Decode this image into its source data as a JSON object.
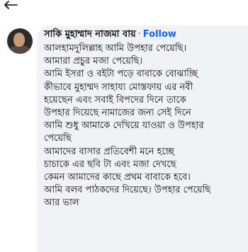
{
  "comment": {
    "author_name": "সাকি মুহাম্মাদ নাজমা বায়",
    "separator": "·",
    "follow_label": "Follow",
    "body_lines": [
      "আলহামদুলিল্লাহ আমি উপহার পেয়েছি।",
      "আমারা প্রচুর মজা পেয়েছি।",
      "আমি ইসরা ও বইটা পড়ে বাবাকে বোঝাচ্ছি",
      "কীভাবে মুহাম্মদ সাহায্য মোস্তফায় এর নবী",
      "হয়েছেন এবং সবাই বিপদের দিনে তাকে",
      "উপহার দিয়েছে নামাজের জন্য সেই দিনে",
      "আমি শুধু আমাকে দেখিয়ে যাওয়া ও উপহার",
      "পেয়েছি",
      "আমাদের বাসার প্রতিবেশী মনে হচ্ছে",
      "চাচাকে এর ছবি টা এবং মজা দেখছে",
      "কেমন আমাদের কাছে প্রথম বাবাকে হবে।",
      "আমি বলব পাঠকদের দিয়েছে। উপহার পেয়েছি",
      "আর ভাল"
    ]
  }
}
